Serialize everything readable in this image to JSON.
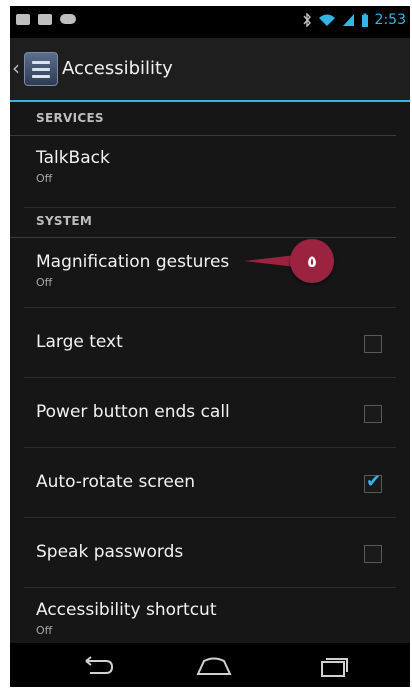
{
  "status_bar": {
    "time": "2:53",
    "left_icons": [
      "message-icon",
      "image-icon",
      "voicemail-icon"
    ],
    "right_icons": [
      "bluetooth-icon",
      "wifi-icon",
      "signal-icon",
      "battery-icon"
    ]
  },
  "action_bar": {
    "title": "Accessibility",
    "icon": "accessibility-settings-icon"
  },
  "sections": {
    "services": {
      "header": "SERVICES",
      "items": [
        {
          "title": "TalkBack",
          "summary": "Off"
        }
      ]
    },
    "system": {
      "header": "SYSTEM",
      "items": [
        {
          "title": "Magnification gestures",
          "summary": "Off"
        },
        {
          "title": "Large text",
          "checked": false
        },
        {
          "title": "Power button ends call",
          "checked": false
        },
        {
          "title": "Auto-rotate screen",
          "checked": true
        },
        {
          "title": "Speak passwords",
          "checked": false
        },
        {
          "title": "Accessibility shortcut",
          "summary": "Off"
        }
      ]
    }
  },
  "callout": {
    "label": "٥",
    "color": "#9b2340"
  },
  "nav_bar": {
    "buttons": [
      "back-icon",
      "home-icon",
      "recents-icon"
    ]
  },
  "colors": {
    "accent": "#33b5e5",
    "background": "#161616"
  }
}
